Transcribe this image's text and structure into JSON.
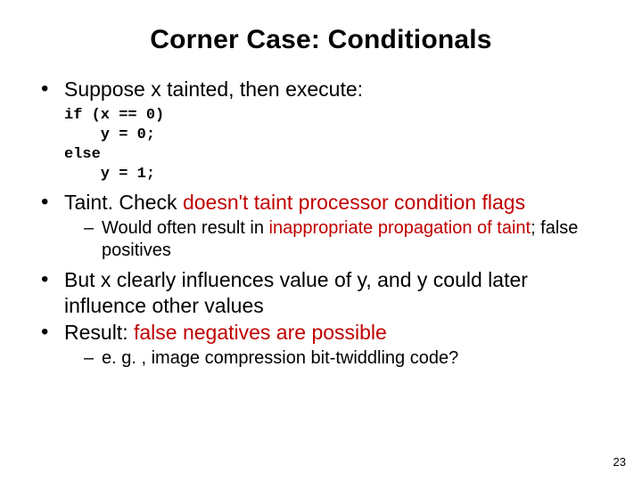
{
  "title": "Corner Case: Conditionals",
  "bullets": {
    "b1": "Suppose x tainted, then execute:",
    "code": "if (x == 0)\n    y = 0;\nelse\n    y = 1;",
    "b2_pre": "Taint. Check ",
    "b2_red": "doesn't taint processor condition flags",
    "b2_sub_pre": "Would often result in ",
    "b2_sub_red": "inappropriate propagation of taint",
    "b2_sub_post": "; false positives",
    "b3": "But x clearly influences value of y, and y could later influence other values",
    "b4_pre": "Result: ",
    "b4_red": "false negatives are possible",
    "b4_sub": "e. g. , image compression bit-twiddling code?"
  },
  "page_number": "23"
}
